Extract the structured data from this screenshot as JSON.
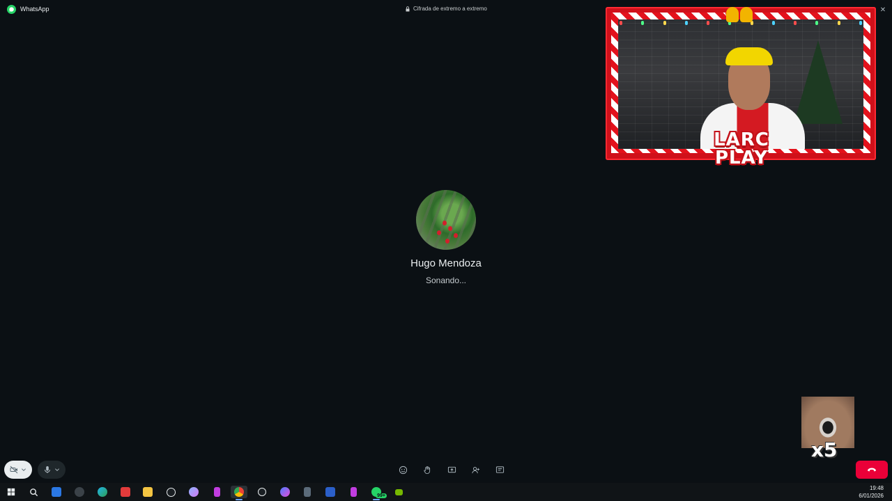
{
  "titlebar": {
    "app_name": "WhatsApp",
    "encryption_label": "Cifrada de extremo a extremo",
    "icons": [
      "whatsapp-logo-icon",
      "lock-icon",
      "minimize-icon",
      "maximize-icon",
      "close-icon"
    ]
  },
  "overlay": {
    "brand_line1": "LARC",
    "brand_line2": "PLAY"
  },
  "call": {
    "contact_name": "Hugo Mendoza",
    "status": "Sonando..."
  },
  "reaction": {
    "count": "x5"
  },
  "controls": {
    "left": [
      "camera-off-icon",
      "microphone-icon"
    ],
    "center": [
      "emoji-icon",
      "raise-hand-icon",
      "screen-share-icon",
      "add-participant-icon",
      "chat-icon"
    ],
    "right": [
      "end-call-icon"
    ]
  },
  "taskbar": {
    "apps": [
      "windows-start-icon",
      "search-icon",
      "store-icon",
      "cat-app-icon",
      "edge-icon",
      "red-app-icon",
      "file-explorer-icon",
      "logitech-icon",
      "feather-app-icon",
      "pink-app-icon",
      "chrome-icon",
      "clock-app-icon",
      "messenger-icon",
      "calculator-icon",
      "word-icon",
      "pink-app-2-icon",
      "whatsapp-icon",
      "nvidia-icon"
    ],
    "whatsapp_badge": "99+",
    "time": "19:48",
    "date": "6/01/2026"
  },
  "colors": {
    "background": "#0b1014",
    "accent": "#25d366",
    "hangup": "#ea0038"
  }
}
